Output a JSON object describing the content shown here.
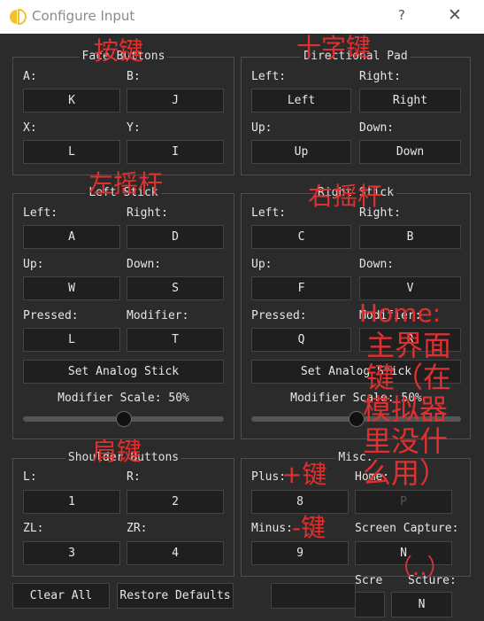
{
  "window": {
    "title": "Configure Input",
    "help": "?",
    "close": "✕"
  },
  "face": {
    "title": "Face Buttons",
    "a_label": "A:",
    "a_value": "K",
    "b_label": "B:",
    "b_value": "J",
    "x_label": "X:",
    "x_value": "L",
    "y_label": "Y:",
    "y_value": "I"
  },
  "dpad": {
    "title": "Directional Pad",
    "left_label": "Left:",
    "left_value": "Left",
    "right_label": "Right:",
    "right_value": "Right",
    "up_label": "Up:",
    "up_value": "Up",
    "down_label": "Down:",
    "down_value": "Down"
  },
  "left_stick": {
    "title": "Left Stick",
    "left_label": "Left:",
    "left_value": "A",
    "right_label": "Right:",
    "right_value": "D",
    "up_label": "Up:",
    "up_value": "W",
    "down_label": "Down:",
    "down_value": "S",
    "pressed_label": "Pressed:",
    "pressed_value": "L",
    "modifier_label": "Modifier:",
    "modifier_value": "T",
    "set_analog": "Set Analog Stick",
    "modifier_scale": "Modifier Scale: 50%",
    "scale_percent": 50
  },
  "right_stick": {
    "title": "Right Stick",
    "left_label": "Left:",
    "left_value": "C",
    "right_label": "Right:",
    "right_value": "B",
    "up_label": "Up:",
    "up_value": "F",
    "down_label": "Down:",
    "down_value": "V",
    "pressed_label": "Pressed:",
    "pressed_value": "Q",
    "modifier_label": "Modifier:",
    "modifier_value": "R",
    "set_analog": "Set Analog Stick",
    "modifier_scale": "Modifier Scale: 50%",
    "scale_percent": 50
  },
  "shoulder": {
    "title": "Shoulder Buttons",
    "l_label": "L:",
    "l_value": "1",
    "r_label": "R:",
    "r_value": "2",
    "zl_label": "ZL:",
    "zl_value": "3",
    "zr_label": "ZR:",
    "zr_value": "4"
  },
  "misc": {
    "title": "Misc.",
    "plus_label": "Plus:",
    "plus_value": "8",
    "home_label": "Home:",
    "home_value": "P",
    "minus_label": "Minus:",
    "minus_value": "9",
    "capture_label": "Screen Capture:",
    "capture_value": "N",
    "capture2_label_a": "Scre",
    "capture2_label_b": "Scture:",
    "capture2_value": "N"
  },
  "footer": {
    "clear_all": "Clear All",
    "restore_defaults": "Restore Defaults"
  },
  "annotations": {
    "face": "按键",
    "dpad": "十字键",
    "left_stick": "左摇杆",
    "right_stick": "右摇杆",
    "shoulder": "肩键",
    "plus": "+键",
    "minus": "-键",
    "home_lines": [
      "Home:",
      "主界面",
      "键（在",
      "模拟器",
      "里没什",
      "么用）"
    ],
    "extra": "（..）"
  },
  "colors": {
    "annotation": "#e03030",
    "background": "#2b2b2b",
    "button": "#1f1f1f",
    "titlebar": "#ffffff",
    "logo_yellow": "#f2c12e"
  }
}
